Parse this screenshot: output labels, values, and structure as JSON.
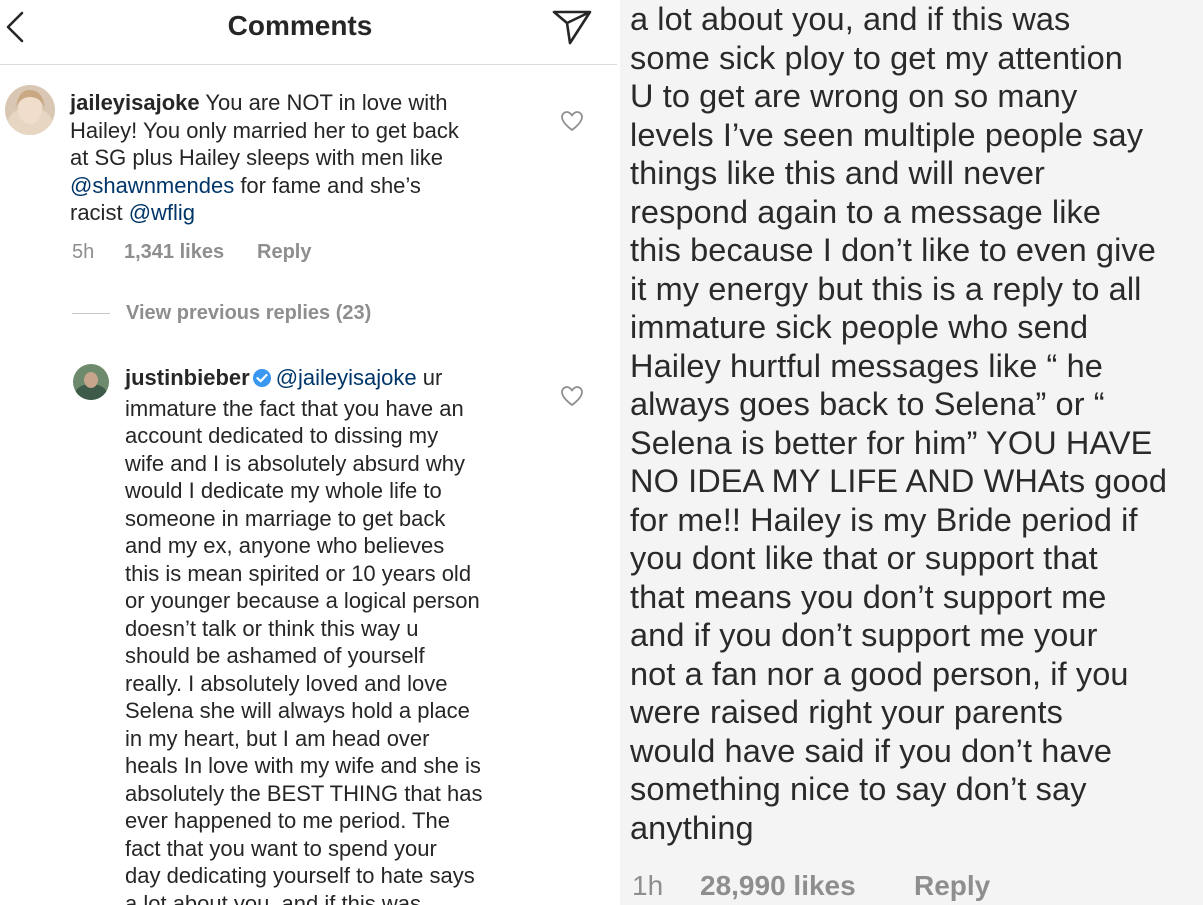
{
  "header": {
    "title": "Comments",
    "back_icon": "chevron-left-icon",
    "share_icon": "paper-plane-icon"
  },
  "comment1": {
    "username": "jaileyisajoke",
    "text_1": " You are NOT in love with",
    "text_2": "Hailey! You only married her to get back",
    "text_3": "at SG plus Hailey sleeps with men like",
    "mention_1": "@shawnmendes",
    "text_4": " for fame and she’s",
    "text_5": "racist ",
    "mention_2": "@wflig",
    "time": "5h",
    "likes": "1,341 likes",
    "reply": "Reply"
  },
  "view_previous": "View previous replies (23)",
  "comment2": {
    "username": "justinbieber",
    "mention": "@jaileyisajoke",
    "first_line_rest": " ur",
    "lines": [
      "immature the fact that you have an",
      "account dedicated to dissing my",
      "wife and I is absolutely absurd why",
      "would I dedicate my whole life to",
      "someone in marriage to get back",
      "and my ex, anyone who believes",
      "this is mean spirited or 10 years old",
      "or younger because a logical person",
      "doesn’t talk or think this way u",
      "should be ashamed of yourself",
      "really.  I absolutely loved and love",
      "Selena she will always hold a place",
      "in my heart, but I am head over",
      "heals In love with my wife and she is",
      "absolutely the BEST THING that has",
      "ever happened to me period. The",
      "fact that you want to spend your",
      "day dedicating yourself to hate says",
      "a lot about you, and if this was"
    ]
  },
  "right_panel": {
    "lines": [
      "a lot about you, and if this was",
      "some sick ploy to get my attention",
      "U to get are wrong on so many",
      "levels I’ve seen multiple people say",
      "things like this and will never",
      "respond again to a message like",
      "this because I don’t like to even give",
      "it my energy but this is a reply to all",
      "immature sick people who send",
      "Hailey hurtful messages like “ he",
      "always goes back to Selena” or “",
      "Selena is better for him” YOU HAVE",
      "NO IDEA MY LIFE AND WHAts good",
      "for me!! Hailey is my Bride period if",
      "you dont like that or support that",
      "that means you don’t support me",
      "and if you don’t support me your",
      "not a fan nor a good person, if you",
      "were raised right your parents",
      "would have said if you don’t have",
      "something nice to say don’t say",
      "anything"
    ],
    "time": "1h",
    "likes": "28,990 likes",
    "reply": "Reply"
  },
  "colors": {
    "mention": "#003569",
    "meta": "#8e8e8e",
    "verified": "#3897f0",
    "text": "#262626"
  }
}
